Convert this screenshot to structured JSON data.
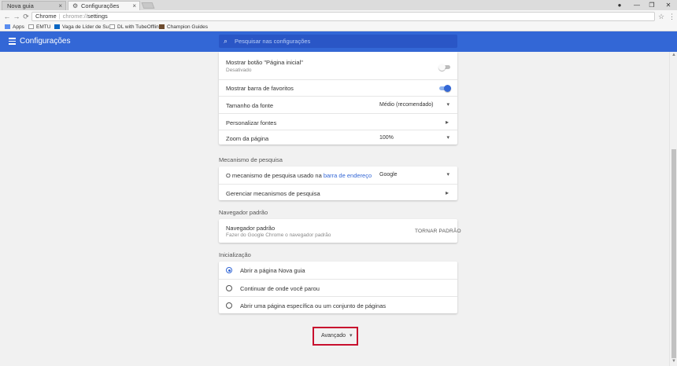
{
  "tabs": [
    {
      "title": "Nova guia",
      "close": "×"
    },
    {
      "title": "Configurações",
      "close": "×",
      "icon": "gear-icon"
    }
  ],
  "window": {
    "minimize": "—",
    "maximize": "❐",
    "close": "✕",
    "profile": "●"
  },
  "nav": {
    "back": "←",
    "forward": "→",
    "reload": "⟳"
  },
  "omnibox": {
    "site": "Chrome",
    "scheme": "chrome://",
    "path": "settings",
    "star": "☆",
    "menu": "⋮"
  },
  "bookmarks": [
    {
      "label": "Apps",
      "color": "#5a8def"
    },
    {
      "label": "EMTU",
      "color": "#888888"
    },
    {
      "label": "Vaga de Líder de Su",
      "color": "#0a66c2"
    },
    {
      "label": "DL with TubeOffline",
      "color": "#888888"
    },
    {
      "label": "Champion Guides",
      "color": "#6d4c2f"
    }
  ],
  "header": {
    "title": "Configurações",
    "search_placeholder": "Pesquisar nas configurações",
    "accent": "#3367d6"
  },
  "appearance": {
    "home_button": {
      "label": "Mostrar botão \"Página inicial\"",
      "sub": "Desativado",
      "enabled": false
    },
    "bookmarks_bar": {
      "label": "Mostrar barra de favoritos",
      "enabled": true
    },
    "font_size": {
      "label": "Tamanho da fonte",
      "value": "Médio (recomendado)"
    },
    "customize_fonts": {
      "label": "Personalizar fontes"
    },
    "page_zoom": {
      "label": "Zoom da página",
      "value": "100%"
    }
  },
  "search_engine": {
    "title": "Mecanismo de pesquisa",
    "used_prefix": "O mecanismo de pesquisa usado na",
    "used_link": "barra de endereço",
    "used_value": "Google",
    "manage": "Gerenciar mecanismos de pesquisa"
  },
  "default_browser": {
    "title": "Navegador padrão",
    "label": "Navegador padrão",
    "sub": "Fazer do Google Chrome o navegador padrão",
    "button": "TORNAR PADRÃO"
  },
  "startup": {
    "title": "Inicialização",
    "options": [
      {
        "label": "Abrir a página Nova guia",
        "checked": true
      },
      {
        "label": "Continuar de onde você parou",
        "checked": false
      },
      {
        "label": "Abrir uma página específica ou um conjunto de páginas",
        "checked": false
      }
    ]
  },
  "advanced": {
    "label": "Avançado",
    "highlight_color": "#c8102e"
  },
  "icons": {
    "chevron": "▾",
    "arrow": "▸",
    "search": "⌕"
  }
}
